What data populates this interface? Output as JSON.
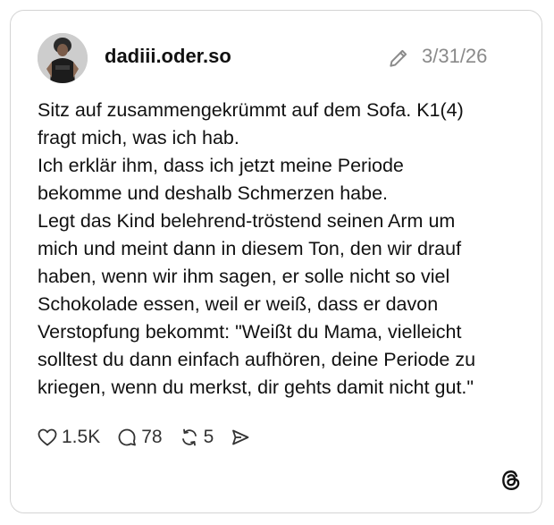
{
  "post": {
    "username": "dadiii.oder.so",
    "date": "3/31/26",
    "lines": [
      "Sitz auf zusammengekrümmt auf dem Sofa. K1(4)",
      "fragt mich, was ich hab.",
      "Ich erklär ihm, dass ich jetzt meine Periode",
      "bekomme und deshalb Schmerzen habe.",
      "Legt das Kind belehrend-tröstend seinen Arm um",
      "mich und meint dann in diesem Ton, den wir drauf",
      "haben, wenn wir ihm sagen, er solle nicht so viel",
      "Schokolade essen, weil er weiß, dass er davon",
      "Verstopfung bekommt: \"Weißt du Mama, vielleicht",
      "solltest du dann einfach aufhören, deine Periode zu",
      "kriegen, wenn du merkst, dir gehts damit nicht gut.\""
    ]
  },
  "actions": {
    "likes": "1.5K",
    "comments": "78",
    "reposts": "5"
  },
  "icons": {
    "edit": "pencil-icon",
    "like": "heart-icon",
    "comment": "comment-bubble-icon",
    "repost": "repost-icon",
    "share": "send-icon",
    "brand": "threads-logo-icon"
  },
  "colors": {
    "text": "#111111",
    "muted": "#8a8a8a",
    "border": "#d4d4d4"
  }
}
